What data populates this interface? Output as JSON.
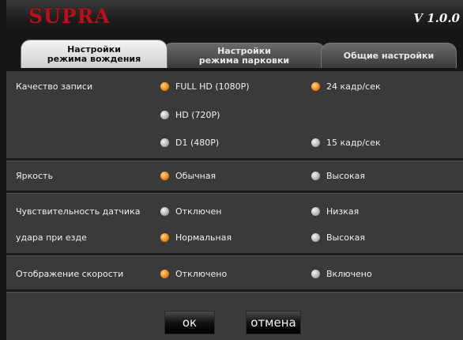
{
  "header": {
    "logo": "SUPRA",
    "version": "V 1.0.0"
  },
  "tabs": [
    {
      "line1": "Настройки",
      "line2": "режима вождения",
      "active": true
    },
    {
      "line1": "Настройки",
      "line2": "режима парковки",
      "active": false
    },
    {
      "line1": "Общие настройки",
      "line2": "",
      "active": false
    }
  ],
  "settings": {
    "quality": {
      "label": "Качество записи",
      "resolutions": [
        {
          "label": "FULL HD (1080P)",
          "selected": true
        },
        {
          "label": "HD (720P)",
          "selected": false
        },
        {
          "label": "D1 (480P)",
          "selected": false
        }
      ],
      "framerates": [
        {
          "label": "24 кадр/сек",
          "selected": true
        },
        {
          "label": "15 кадр/сек",
          "selected": false
        }
      ]
    },
    "brightness": {
      "label": "Яркость",
      "options": [
        {
          "label": "Обычная",
          "selected": true
        },
        {
          "label": "Высокая",
          "selected": false
        }
      ]
    },
    "sensitivity": {
      "label_line1": "Чувствительность датчика",
      "label_line2": "удара при езде",
      "options": [
        {
          "label": "Отключен",
          "selected": false
        },
        {
          "label": "Низкая",
          "selected": false
        },
        {
          "label": "Нормальная",
          "selected": true
        },
        {
          "label": "Высокая",
          "selected": false
        }
      ]
    },
    "speed_display": {
      "label": "Отображение скорости",
      "options": [
        {
          "label": "Отключено",
          "selected": true
        },
        {
          "label": "Включено",
          "selected": false
        }
      ]
    }
  },
  "buttons": {
    "ok": "ок",
    "cancel": "отмена"
  },
  "colors": {
    "logo": "#b0141c",
    "radio_on": "#f08a1a",
    "radio_off": "#b8b8b8",
    "panel": "#3a3a3a"
  }
}
